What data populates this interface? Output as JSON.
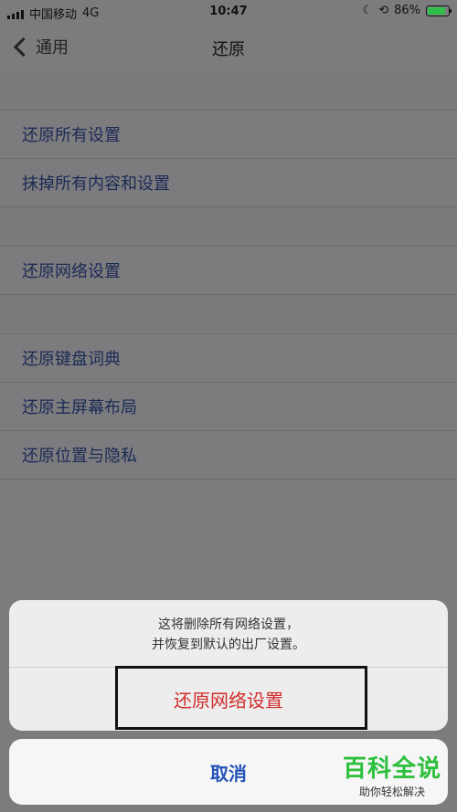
{
  "statusbar": {
    "carrier": "中国移动",
    "network": "4G",
    "time": "10:47",
    "battery_percent": "86%",
    "battery_level": 0.86
  },
  "nav": {
    "back_label": "通用",
    "title": "还原"
  },
  "sections": [
    {
      "items": [
        "还原所有设置",
        "抹掉所有内容和设置"
      ]
    },
    {
      "items": [
        "还原网络设置"
      ]
    },
    {
      "items": [
        "还原键盘词典",
        "还原主屏幕布局",
        "还原位置与隐私"
      ]
    }
  ],
  "sheet": {
    "message_line1": "这将删除所有网络设置，",
    "message_line2": "并恢复到默认的出厂设置。",
    "action_label": "还原网络设置",
    "cancel_label": "取消"
  },
  "watermark": {
    "main": "百科全说",
    "sub": "助你轻松解决"
  },
  "colors": {
    "destructive": "#d12d2d",
    "cancel": "#2453b9",
    "watermark_green": "#2bbf3c",
    "battery_green": "#2fbf4a"
  },
  "icons": {
    "signal": "signal-bars-icon",
    "moon": "moon-icon",
    "lock_rotation": "rotation-lock-icon",
    "battery": "battery-icon",
    "back": "chevron-left-icon"
  }
}
